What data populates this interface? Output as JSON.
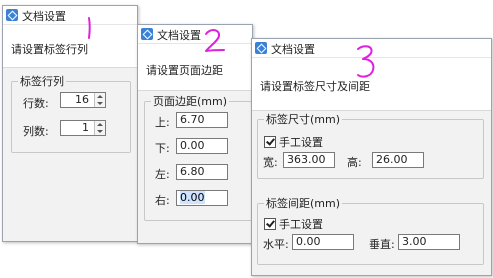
{
  "dialog1": {
    "title": "文档设置",
    "prompt": "请设置标签行列",
    "group_title": "标签行列",
    "rows_label": "行数:",
    "rows_value": "16",
    "cols_label": "列数:",
    "cols_value": "1"
  },
  "dialog2": {
    "title": "文档设置",
    "prompt": "请设置页面边距",
    "group_title": "页面边距(mm)",
    "top_label": "上:",
    "top_value": "6.70",
    "bottom_label": "下:",
    "bottom_value": "0.00",
    "left_label": "左:",
    "left_value": "6.80",
    "right_label": "右:",
    "right_value": "0.00"
  },
  "dialog3": {
    "title": "文档设置",
    "prompt": "请设置标签尺寸及间距",
    "size_group_title": "标签尺寸(mm)",
    "size_manual_label": "手工设置",
    "width_label": "宽:",
    "width_value": "363.00",
    "height_label": "高:",
    "height_value": "26.00",
    "gap_group_title": "标签间距(mm)",
    "gap_manual_label": "手工设置",
    "horizontal_label": "水平:",
    "horizontal_value": "0.00",
    "vertical_label": "垂直:",
    "vertical_value": "3.00"
  },
  "annotations": {
    "step1": "1",
    "step2": "2",
    "step3": "3",
    "color": "#e020e0"
  },
  "colors": {
    "icon_blue": "#3b82d6",
    "selection": "#cfe3ff"
  }
}
